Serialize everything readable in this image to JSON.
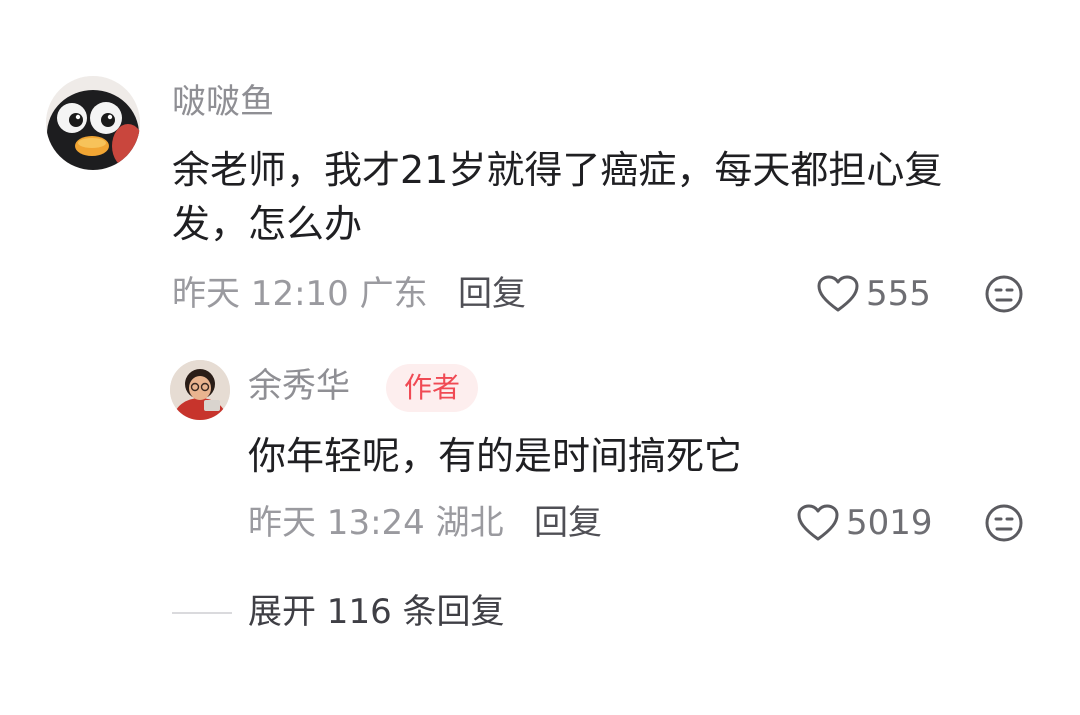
{
  "comment": {
    "username": "啵啵鱼",
    "text_line1": "余老师，我才21岁就得了癌症，每天都担心复",
    "text_line2": "发，怎么办",
    "time_location": "昨天 12:10 广东",
    "reply_label": "回复",
    "like_count": "555",
    "like_icon": "heart-outline-icon",
    "dislike_icon": "neutral-face-icon"
  },
  "reply": {
    "username": "余秀华",
    "badge": "作者",
    "text": "你年轻呢，有的是时间搞死它",
    "time_location": "昨天 13:24 湖北",
    "reply_label": "回复",
    "like_count": "5019",
    "like_icon": "heart-outline-icon",
    "dislike_icon": "neutral-face-icon"
  },
  "expand": {
    "label": "展开 116 条回复"
  },
  "colors": {
    "badge_text": "#f04a54",
    "badge_bg": "#fdeeee",
    "muted_text": "#9a9a9f",
    "body_text": "#1f1f22"
  }
}
